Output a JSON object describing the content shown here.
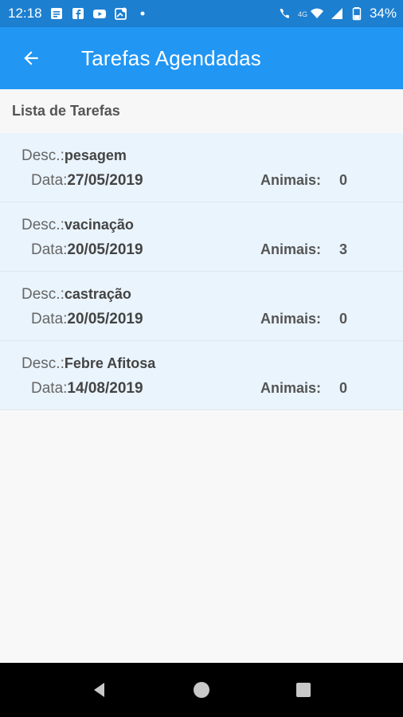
{
  "status_bar": {
    "time": "12:18",
    "network_label": "4G",
    "battery": "34%",
    "icons": [
      "message-icon",
      "facebook-icon",
      "youtube-icon",
      "map-icon",
      "dot-icon",
      "call-4g-icon",
      "wifi-icon",
      "signal-icon",
      "battery-icon"
    ]
  },
  "app_bar": {
    "title": "Tarefas Agendadas",
    "back_icon": "arrow-back-icon",
    "background": "#2196f3"
  },
  "list": {
    "header": "Lista de Tarefas",
    "labels": {
      "desc": "Desc.:",
      "data": "Data:",
      "animais": "Animais:"
    },
    "items": [
      {
        "desc": "pesagem",
        "data": "27/05/2019",
        "animais": "0"
      },
      {
        "desc": "vacinação",
        "data": "20/05/2019",
        "animais": "3"
      },
      {
        "desc": "castração",
        "data": "20/05/2019",
        "animais": "0"
      },
      {
        "desc": "Febre Afitosa",
        "data": "14/08/2019",
        "animais": "0"
      }
    ]
  },
  "nav_bar": {
    "icons": [
      "back-triangle-icon",
      "home-circle-icon",
      "recents-square-icon"
    ]
  }
}
